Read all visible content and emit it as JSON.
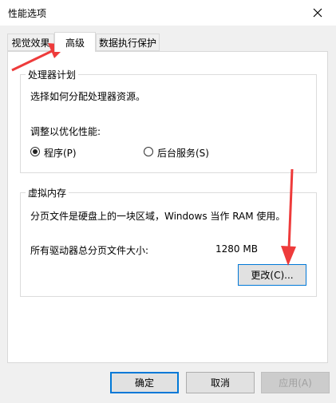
{
  "window": {
    "title": "性能选项"
  },
  "tabs": [
    {
      "label": "视觉效果"
    },
    {
      "label": "高级"
    },
    {
      "label": "数据执行保护"
    }
  ],
  "processor": {
    "group_title": "处理器计划",
    "description": "选择如何分配处理器资源。",
    "adjust_label": "调整以优化性能:",
    "options": [
      {
        "label": "程序(P)",
        "checked": true
      },
      {
        "label": "后台服务(S)",
        "checked": false
      }
    ]
  },
  "virtual_memory": {
    "group_title": "虚拟内存",
    "description": "分页文件是硬盘上的一块区域，Windows 当作 RAM 使用。",
    "total_label": "所有驱动器总分页文件大小:",
    "total_value": "1280 MB",
    "change_button": "更改(C)..."
  },
  "footer": {
    "ok": "确定",
    "cancel": "取消",
    "apply": "应用(A)"
  },
  "colors": {
    "annotation_arrow": "#ee3b3b",
    "focus_border": "#0078d7"
  },
  "icons": {
    "close": "close-icon"
  }
}
